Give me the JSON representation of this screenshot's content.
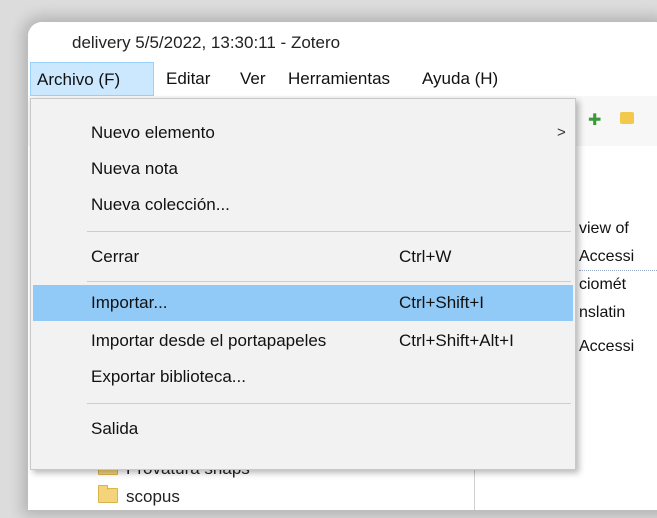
{
  "window": {
    "title": "delivery 5/5/2022, 13:30:11 - Zotero"
  },
  "menubar": {
    "items": [
      {
        "label": "Archivo (F)",
        "active": true
      },
      {
        "label": "Editar",
        "active": false
      },
      {
        "label": "Ver",
        "active": false
      },
      {
        "label": "Herramientas",
        "active": false
      },
      {
        "label": "Ayuda (H)",
        "active": false
      }
    ]
  },
  "file_menu": {
    "items": [
      {
        "label": "Nuevo elemento",
        "shortcut": "",
        "submenu": true
      },
      {
        "label": "Nueva nota",
        "shortcut": ""
      },
      {
        "label": "Nueva colección...",
        "shortcut": ""
      },
      {
        "label": "Cerrar",
        "shortcut": "Ctrl+W"
      },
      {
        "label": "Importar...",
        "shortcut": "Ctrl+Shift+I",
        "highlighted": true
      },
      {
        "label": "Importar desde el portapapeles",
        "shortcut": "Ctrl+Shift+Alt+I"
      },
      {
        "label": "Exportar biblioteca...",
        "shortcut": ""
      },
      {
        "label": "Salida",
        "shortcut": ""
      }
    ],
    "submenu_arrow": ">"
  },
  "collections": [
    {
      "name": "Provatura snaps"
    },
    {
      "name": "scopus"
    }
  ],
  "items_pane": {
    "lines": [
      "view of",
      "Accessi",
      "ciomét",
      "nslatin",
      "Accessi"
    ]
  },
  "colors": {
    "highlight": "#91c9f7",
    "menubar_active": "#cce8ff"
  }
}
